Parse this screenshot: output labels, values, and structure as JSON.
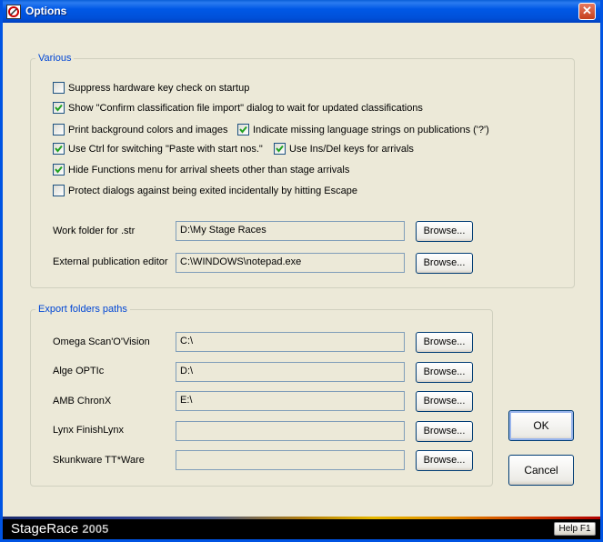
{
  "window": {
    "title": "Options",
    "close_symbol": "✕"
  },
  "various": {
    "legend": "Various",
    "checkboxes": [
      {
        "label": "Suppress hardware key check on startup",
        "checked": false
      },
      {
        "label": "Show \"Confirm classification file import\" dialog to wait for updated classifications",
        "checked": true
      },
      {
        "label": "Print background colors and images",
        "checked": false
      },
      {
        "label": "Indicate missing language strings on publications ('?')",
        "checked": true
      },
      {
        "label": "Use Ctrl for switching \"Paste with start nos.\"",
        "checked": true
      },
      {
        "label": "Use Ins/Del keys for arrivals",
        "checked": true
      },
      {
        "label": "Hide Functions menu for arrival sheets other than stage arrivals",
        "checked": true
      },
      {
        "label": "Protect dialogs against being exited incidentally by hitting Escape",
        "checked": false
      }
    ],
    "work_folder": {
      "label": "Work folder for .str",
      "value": "D:\\My Stage Races",
      "button": "Browse..."
    },
    "editor": {
      "label": "External publication editor",
      "value": "C:\\WINDOWS\\notepad.exe",
      "button": "Browse..."
    }
  },
  "export": {
    "legend": "Export folders paths",
    "rows": [
      {
        "label": "Omega Scan'O'Vision",
        "value": "C:\\",
        "button": "Browse..."
      },
      {
        "label": "Alge OPTIc",
        "value": "D:\\",
        "button": "Browse..."
      },
      {
        "label": "AMB ChronX",
        "value": "E:\\",
        "button": "Browse..."
      },
      {
        "label": "Lynx FinishLynx",
        "value": "",
        "button": "Browse..."
      },
      {
        "label": "Skunkware TT*Ware",
        "value": "",
        "button": "Browse..."
      }
    ]
  },
  "actions": {
    "ok": "OK",
    "cancel": "Cancel"
  },
  "footer": {
    "brand": "StageRace",
    "year": "2005",
    "help": "Help F1"
  }
}
